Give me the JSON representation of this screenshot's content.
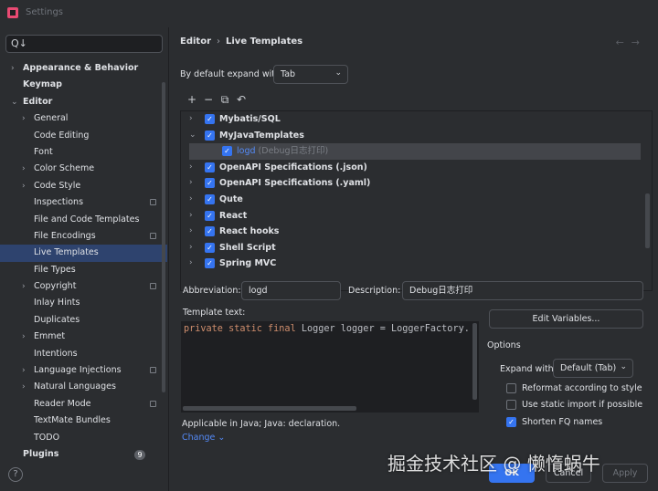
{
  "window": {
    "title": "Settings"
  },
  "search": {
    "placeholder": "Q↓"
  },
  "sidebar": {
    "items": [
      {
        "label": "Appearance & Behavior",
        "chevron": "›"
      },
      {
        "label": "Keymap",
        "chevron": ""
      },
      {
        "label": "Editor",
        "chevron": "⌄"
      },
      {
        "label": "General",
        "chevron": "›"
      },
      {
        "label": "Code Editing",
        "chevron": ""
      },
      {
        "label": "Font",
        "chevron": ""
      },
      {
        "label": "Color Scheme",
        "chevron": "›"
      },
      {
        "label": "Code Style",
        "chevron": "›"
      },
      {
        "label": "Inspections",
        "chevron": ""
      },
      {
        "label": "File and Code Templates",
        "chevron": ""
      },
      {
        "label": "File Encodings",
        "chevron": ""
      },
      {
        "label": "Live Templates",
        "chevron": ""
      },
      {
        "label": "File Types",
        "chevron": ""
      },
      {
        "label": "Copyright",
        "chevron": "›"
      },
      {
        "label": "Inlay Hints",
        "chevron": ""
      },
      {
        "label": "Duplicates",
        "chevron": ""
      },
      {
        "label": "Emmet",
        "chevron": "›"
      },
      {
        "label": "Intentions",
        "chevron": ""
      },
      {
        "label": "Language Injections",
        "chevron": "›"
      },
      {
        "label": "Natural Languages",
        "chevron": "›"
      },
      {
        "label": "Reader Mode",
        "chevron": ""
      },
      {
        "label": "TextMate Bundles",
        "chevron": ""
      },
      {
        "label": "TODO",
        "chevron": ""
      },
      {
        "label": "Plugins",
        "chevron": "",
        "badge": "9"
      }
    ],
    "help": "?"
  },
  "breadcrumb": {
    "parent": "Editor",
    "separator": "›",
    "current": "Live Templates"
  },
  "nav": {
    "back": "←",
    "forward": "→"
  },
  "expand_default": {
    "label": "By default expand with",
    "value": "Tab"
  },
  "toolbar": {
    "add": "+",
    "remove": "−",
    "copy": "⧉",
    "restore": "↶"
  },
  "templates": [
    {
      "label": "Mybatis/SQL",
      "chevron": "›",
      "checked": true
    },
    {
      "label": "MyJavaTemplates",
      "chevron": "⌄",
      "checked": true
    },
    {
      "label": "logd",
      "desc": "(Debug日志打印)",
      "checked": true
    },
    {
      "label": "OpenAPI Specifications (.json)",
      "chevron": "›",
      "checked": true
    },
    {
      "label": "OpenAPI Specifications (.yaml)",
      "chevron": "›",
      "checked": true
    },
    {
      "label": "Qute",
      "chevron": "›",
      "checked": true
    },
    {
      "label": "React",
      "chevron": "›",
      "checked": true
    },
    {
      "label": "React hooks",
      "chevron": "›",
      "checked": true
    },
    {
      "label": "Shell Script",
      "chevron": "›",
      "checked": true
    },
    {
      "label": "Spring MVC",
      "chevron": "›",
      "checked": true
    }
  ],
  "abbreviation": {
    "label": "Abbreviation:",
    "value": "logd"
  },
  "description": {
    "label": "Description:",
    "value": "Debug日志打印"
  },
  "template_text": {
    "label": "Template text:",
    "kw1": "private",
    "kw2": "static",
    "kw3": "final",
    "rest": "Logger logger = LoggerFactory."
  },
  "edit_variables": "Edit Variables...",
  "options": {
    "title": "Options",
    "expand_with_label": "Expand with",
    "expand_with_value": "Default (Tab)",
    "reformat": {
      "label": "Reformat according to style",
      "checked": false
    },
    "static_import": {
      "label": "Use static import if possible",
      "checked": false
    },
    "shorten_fq": {
      "label": "Shorten FQ names",
      "checked": true
    }
  },
  "applicable": "Applicable in Java; Java: declaration.",
  "change_link": "Change ⌄",
  "buttons": {
    "ok": "OK",
    "cancel": "Cancel",
    "apply": "Apply"
  },
  "watermark": "掘金技术社区 @ 懒惰蜗牛",
  "colors": {
    "accent": "#3574f0",
    "selected_bg": "#2e436e",
    "link": "#548af7",
    "background": "#2b2d30"
  }
}
